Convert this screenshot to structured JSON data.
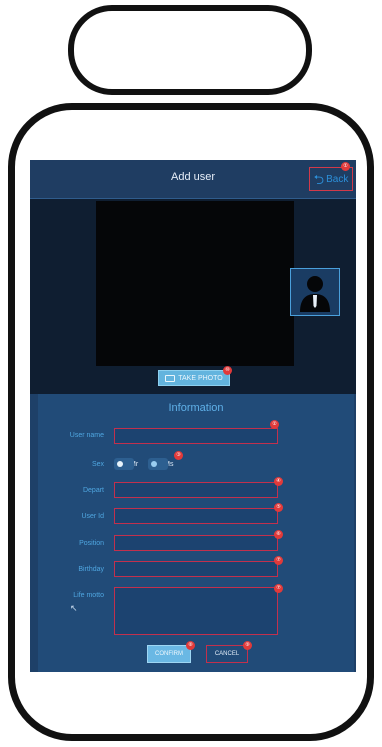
{
  "screen": {
    "title": "Add user"
  },
  "back_button": {
    "label": "Back",
    "badge": "①"
  },
  "camera": {
    "take_photo_label": "TAKE PHOTO",
    "take_photo_badge": "⑩"
  },
  "info": {
    "title": "Information",
    "fields": [
      {
        "label": "User name",
        "badge": "②"
      },
      {
        "label": "Sex",
        "badge": "③"
      },
      {
        "label": "Depart",
        "badge": "④"
      },
      {
        "label": "User Id",
        "badge": "⑤"
      },
      {
        "label": "Position",
        "badge": "⑥"
      },
      {
        "label": "Birthday",
        "badge": "⑦"
      },
      {
        "label": "Life motto",
        "badge": "⑦"
      }
    ],
    "sex_options": [
      {
        "label": "Mr",
        "selected": true
      },
      {
        "label": "Ms",
        "selected": false
      }
    ]
  },
  "actions": {
    "confirm_label": "CONFIRM",
    "confirm_badge": "⑧",
    "cancel_label": "CANCEL",
    "cancel_badge": "⑨"
  },
  "icons": {
    "back": "back-arrow-icon",
    "camera": "camera-icon",
    "avatar": "user-avatar-icon",
    "cursor": "pointer-icon"
  },
  "colors": {
    "screen_bg": "#1e4068",
    "accent_blue": "#4fa6e0",
    "field_border": "#c2304d",
    "badge": "#e13a3a",
    "button_blue": "#6ab8e4"
  }
}
